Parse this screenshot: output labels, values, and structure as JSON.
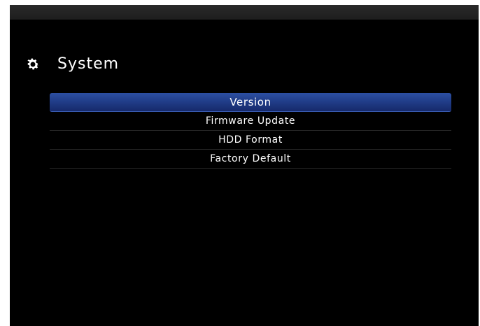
{
  "header": {
    "icon": "gear-icon",
    "title": "System"
  },
  "menu": {
    "items": [
      {
        "label": "Version",
        "selected": true
      },
      {
        "label": "Firmware Update",
        "selected": false
      },
      {
        "label": "HDD Format",
        "selected": false
      },
      {
        "label": "Factory Default",
        "selected": false
      }
    ]
  },
  "colors": {
    "background": "#000000",
    "highlight": "#1f3a84",
    "text": "#ffffff"
  }
}
